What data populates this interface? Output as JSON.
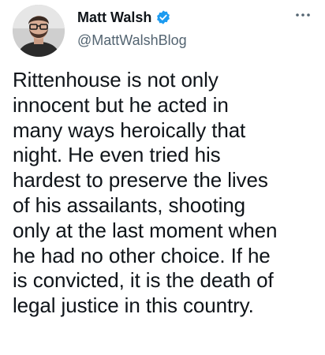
{
  "tweet": {
    "author": {
      "display_name": "Matt Walsh",
      "handle": "@MattWalshBlog",
      "verified": true,
      "avatar_icon": "profile-photo"
    },
    "text": "Rittenhouse is not only\ninnocent but he acted in\nmany ways heroically that\nnight. He even tried his\nhardest to preserve the lives\nof his assailants, shooting\nonly at the last moment when\nhe had no other choice. If he\nis convicted, it is the death of\nlegal justice in this country.",
    "more_icon": "more-horizontal-icon"
  },
  "colors": {
    "verified_blue": "#1d9bf0",
    "text_primary": "#0f1419",
    "text_secondary": "#536471"
  }
}
